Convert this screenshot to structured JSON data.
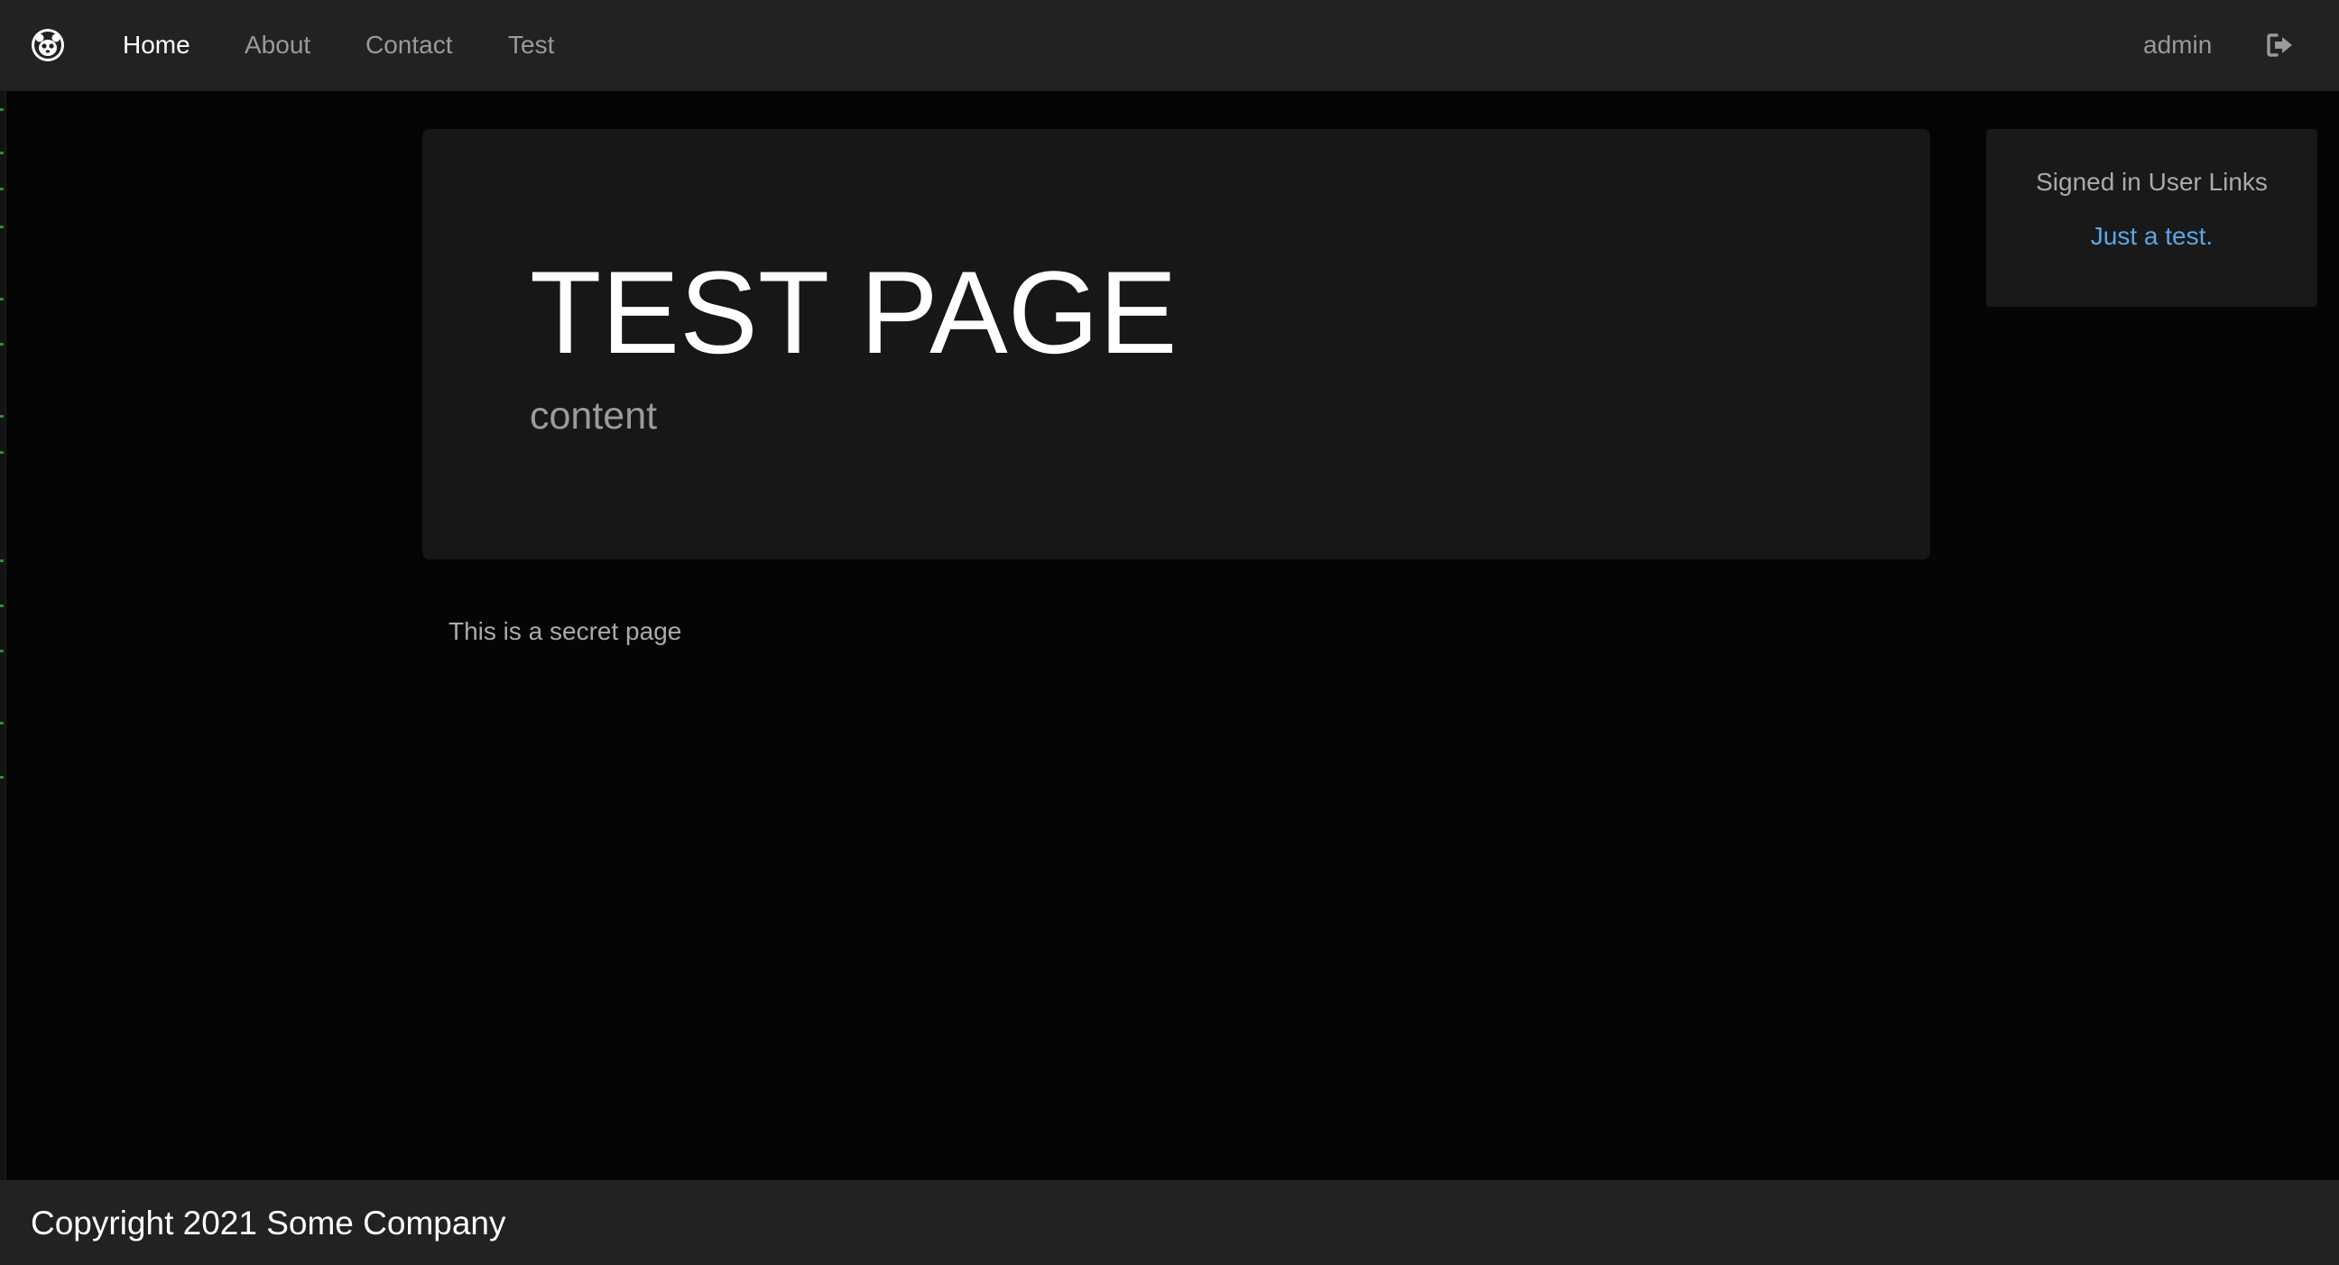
{
  "navbar": {
    "brand_icon": "app-logo-icon",
    "links": [
      {
        "label": "Home",
        "active": true
      },
      {
        "label": "About",
        "active": false
      },
      {
        "label": "Contact",
        "active": false
      },
      {
        "label": "Test",
        "active": false
      }
    ],
    "user_label": "admin",
    "signout_icon": "sign-out-icon"
  },
  "jumbotron": {
    "title": "TEST PAGE",
    "lead": "content"
  },
  "main": {
    "text": "This is a secret page"
  },
  "sidebar": {
    "title": "Signed in User Links",
    "link_label": "Just a test."
  },
  "footer": {
    "text": "Copyright 2021 Some Company"
  },
  "colors": {
    "navbar_bg": "#222222",
    "page_bg": "#050505",
    "card_bg": "#171717",
    "link": "#5aa7e6",
    "muted_text": "#9a9a9a"
  }
}
